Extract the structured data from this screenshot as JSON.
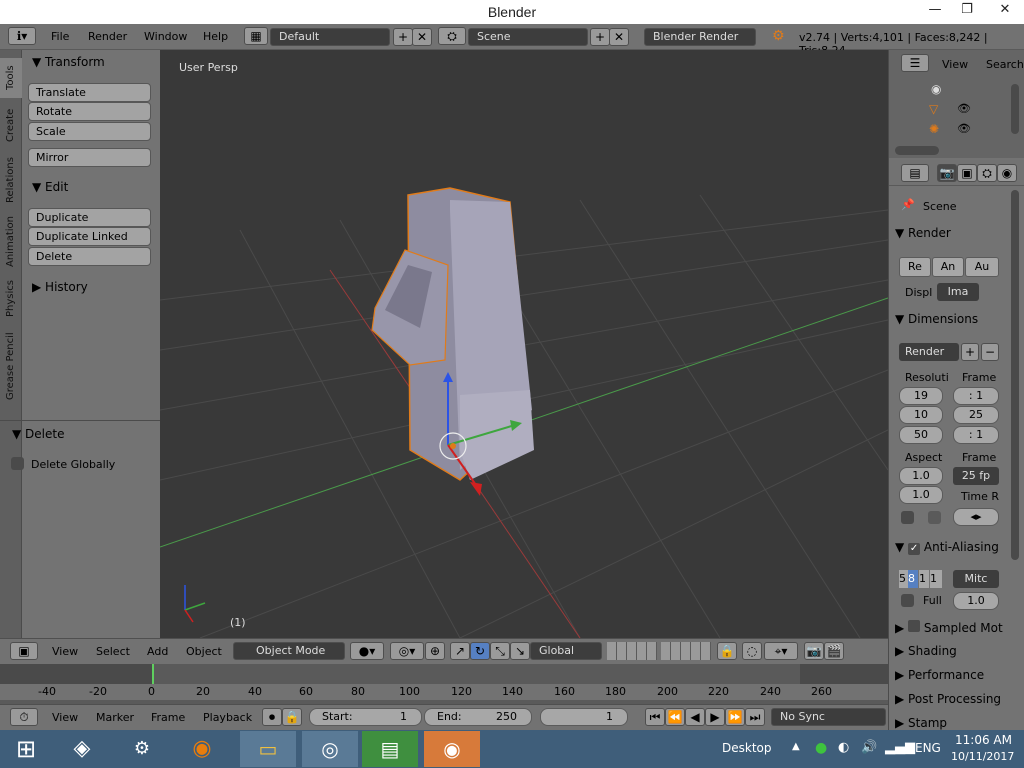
{
  "window": {
    "title": "Blender",
    "min": "—",
    "max": "❐",
    "close": "✕"
  },
  "topbar": {
    "menus": [
      "File",
      "Render",
      "Window",
      "Help"
    ],
    "layout": "Default",
    "scene": "Scene",
    "engine": "Blender Render",
    "stats": "v2.74 | Verts:4,101 | Faces:8,242 | Tris:8,24"
  },
  "tabs": [
    "Tools",
    "Create",
    "Relations",
    "Animation",
    "Physics",
    "Grease Pencil"
  ],
  "toolshelf": {
    "transform_title": "Transform",
    "transform_buttons": [
      "Translate",
      "Rotate",
      "Scale"
    ],
    "mirror": "Mirror",
    "edit_title": "Edit",
    "edit_buttons": [
      "Duplicate",
      "Duplicate Linked",
      "Delete"
    ],
    "history_title": "History",
    "operator_title": "Delete",
    "operator_option": "Delete Globally"
  },
  "viewport": {
    "label": "User Persp",
    "frame": "(1)"
  },
  "view3d_header": {
    "menus": [
      "View",
      "Select",
      "Add",
      "Object"
    ],
    "mode": "Object Mode",
    "orientation": "Global"
  },
  "outliner": {
    "view": "View",
    "search": "Search"
  },
  "properties": {
    "context": "Scene",
    "render_title": "Render",
    "render_buttons": [
      "Re",
      "An",
      "Au"
    ],
    "display_label": "Displ",
    "display_value": "Ima",
    "dimensions_title": "Dimensions",
    "preset": "Render",
    "resolution_label": "Resoluti",
    "frame_label": "Frame",
    "res_x": "19",
    "res_y": "10",
    "res_pct": "50",
    "frame_start": ": 1",
    "frame_end": "25",
    "frame_step": ": 1",
    "aspect_label": "Aspect",
    "frame_rate_label": "Frame",
    "aspect_x": "1.0",
    "aspect_y": "1.0",
    "fps": "25 fp",
    "time_remap_label": "Time R",
    "aa_title": "Anti-Aliasing",
    "aa_samples": [
      "5",
      "8",
      "1",
      "1"
    ],
    "aa_filter": "Mitc",
    "aa_full": "Full",
    "aa_size": "1.0",
    "sections": [
      "Sampled Mot",
      "Shading",
      "Performance",
      "Post Processing",
      "Stamp"
    ]
  },
  "timeline": {
    "ticks": [
      "-40",
      "-20",
      "0",
      "20",
      "40",
      "60",
      "80",
      "100",
      "120",
      "140",
      "160",
      "180",
      "200",
      "220",
      "240",
      "260"
    ],
    "menus": [
      "View",
      "Marker",
      "Frame",
      "Playback"
    ],
    "start_label": "Start:",
    "start": "1",
    "end_label": "End:",
    "end": "250",
    "current": "1",
    "sync": "No Sync"
  },
  "taskbar": {
    "desktop": "Desktop",
    "lang": "ENG",
    "time": "11:06 AM",
    "date": "10/11/2017"
  },
  "colors": {
    "accent": "#5680c2",
    "selection": "#f28a2a"
  }
}
